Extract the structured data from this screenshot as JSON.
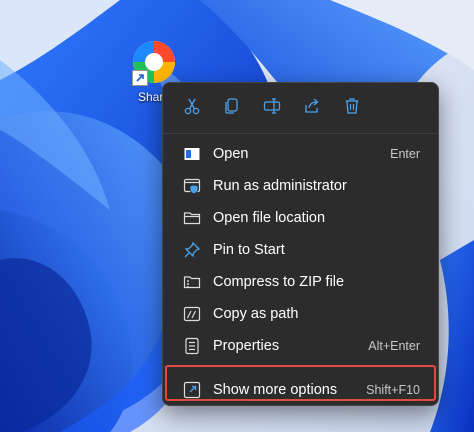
{
  "desktop": {
    "shortcut_label": "Share"
  },
  "toolbar": {
    "buttons": [
      {
        "name": "cut",
        "icon": "scissors-icon"
      },
      {
        "name": "copy",
        "icon": "copy-icon"
      },
      {
        "name": "rename",
        "icon": "rename-icon"
      },
      {
        "name": "share",
        "icon": "share-icon"
      },
      {
        "name": "delete",
        "icon": "trash-icon"
      }
    ]
  },
  "menu": {
    "items": [
      {
        "label": "Open",
        "shortcut": "Enter",
        "icon": "app-window-icon"
      },
      {
        "label": "Run as administrator",
        "shortcut": "",
        "icon": "shield-icon"
      },
      {
        "label": "Open file location",
        "shortcut": "",
        "icon": "folder-icon"
      },
      {
        "label": "Pin to Start",
        "shortcut": "",
        "icon": "pin-icon"
      },
      {
        "label": "Compress to ZIP file",
        "shortcut": "",
        "icon": "zip-folder-icon"
      },
      {
        "label": "Copy as path",
        "shortcut": "",
        "icon": "copy-path-icon"
      },
      {
        "label": "Properties",
        "shortcut": "Alt+Enter",
        "icon": "properties-icon"
      }
    ],
    "more": {
      "label": "Show more options",
      "shortcut": "Shift+F10",
      "icon": "expand-icon"
    }
  },
  "colors": {
    "accent": "#4aa3f0",
    "menu_background": "#2c2c2c",
    "highlight_border": "#e04a3f",
    "wallpaper_blue": "#1a56e0"
  }
}
